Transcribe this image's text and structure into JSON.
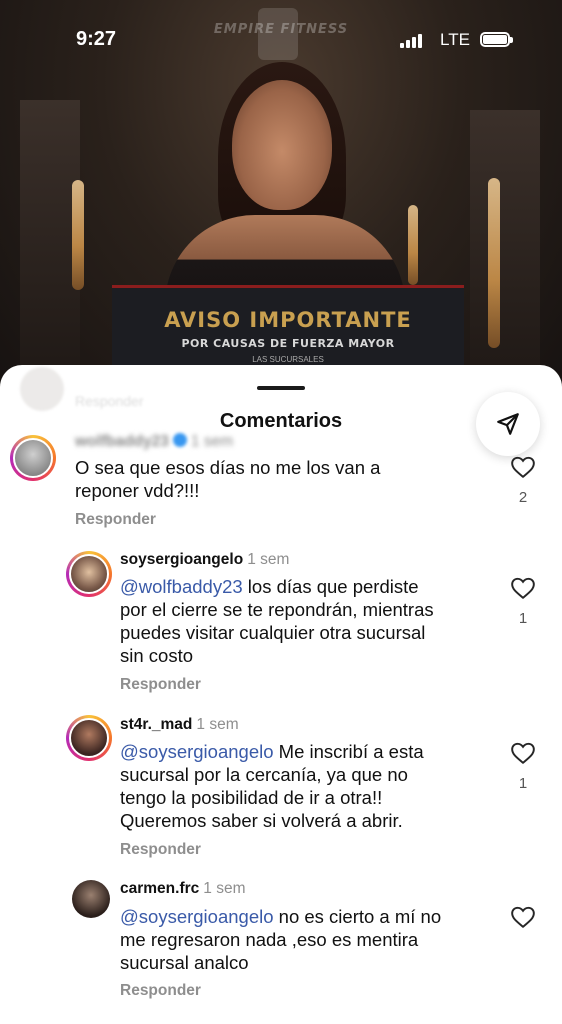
{
  "status_bar": {
    "time": "9:27",
    "network": "LTE"
  },
  "background_post": {
    "brand": "EMPIRE FITNESS",
    "sign_title": "AVISO IMPORTANTE",
    "sign_subtitle": "POR CAUSAS DE FUERZA MAYOR",
    "sign_line": "LAS SUCURSALES"
  },
  "sheet": {
    "title": "Comentarios",
    "share_icon": "send-icon",
    "faded_text": "Responder"
  },
  "comments": [
    {
      "username": "wolfbaddy23",
      "time": "1 sem",
      "mention": "",
      "text_lines": [
        "O sea que esos días no me los van a",
        "reponer vdd?!!!"
      ],
      "reply_label": "Responder",
      "likes": "2"
    },
    {
      "username": "soysergioangelo",
      "time": "1 sem",
      "mention": "@wolfbaddy23",
      "text_lines": [
        " los días que perdiste",
        "por el cierre se te repondrán, mientras",
        "puedes visitar cualquier otra sucursal",
        "sin costo"
      ],
      "reply_label": "Responder",
      "likes": "1"
    },
    {
      "username": "st4r._mad",
      "time": "1 sem",
      "mention": "@soysergioangelo",
      "text_lines": [
        " Me inscribí a esta",
        "sucursal por la cercanía, ya que no",
        "tengo la posibilidad de ir a otra!!",
        "Queremos saber si volverá a abrir."
      ],
      "reply_label": "Responder",
      "likes": "1"
    },
    {
      "username": "carmen.frc",
      "time": "1 sem",
      "mention": "@soysergioangelo",
      "text_lines": [
        " no es cierto a mí no",
        "me regresaron nada ,eso es mentira",
        "sucursal analco"
      ],
      "reply_label": "Responder",
      "likes": ""
    }
  ]
}
